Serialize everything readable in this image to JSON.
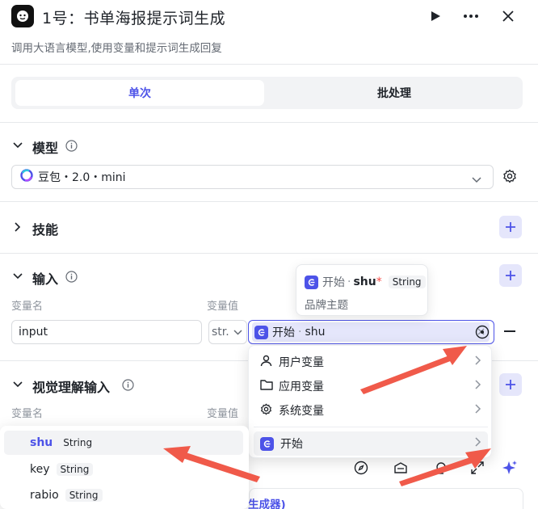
{
  "header": {
    "title": "1号：书单海报提示词生成",
    "description": "调用大语言模型,使用变量和提示词生成回复"
  },
  "tabs": [
    {
      "label": "单次",
      "active": true
    },
    {
      "label": "批处理",
      "active": false
    }
  ],
  "model": {
    "section_title": "模型",
    "selected": "豆包・2.0・mini"
  },
  "skills": {
    "section_title": "技能"
  },
  "input": {
    "section_title": "输入",
    "col_name": "变量名",
    "col_value": "变量值",
    "name_value": "input",
    "type_value": "str.",
    "ref_node": "开始",
    "ref_sep": "·",
    "ref_var": "shu"
  },
  "tooltip": {
    "node": "开始",
    "sep": "·",
    "var": "shu",
    "required_mark": "*",
    "type": "String",
    "description": "品牌主题"
  },
  "dropdown": {
    "items": [
      {
        "label": "用户变量",
        "icon": "user-icon"
      },
      {
        "label": "应用变量",
        "icon": "folder-icon"
      },
      {
        "label": "系统变量",
        "icon": "gear-icon"
      },
      {
        "label": "开始",
        "icon": "start-node-icon"
      }
    ]
  },
  "visual_input": {
    "section_title": "视觉理解输入",
    "col_name": "变量名",
    "col_value": "变量值"
  },
  "submenu": {
    "items": [
      {
        "name": "shu",
        "type": "String",
        "selected": true
      },
      {
        "name": "key",
        "type": "String",
        "selected": false
      },
      {
        "name": "rabio",
        "type": "String",
        "selected": false
      }
    ]
  },
  "prompt_partial": "生成器)",
  "colors": {
    "accent": "#4d53e8",
    "annotation_arrow": "#f05a4a"
  }
}
